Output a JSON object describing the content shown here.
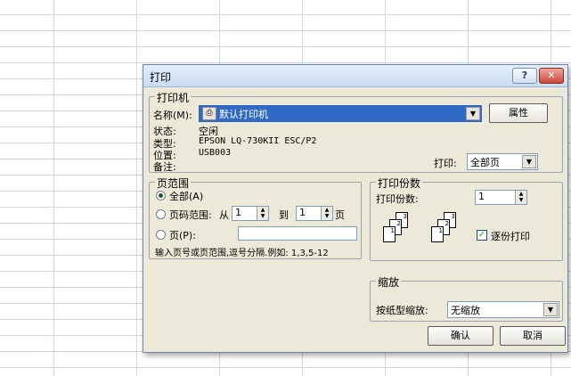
{
  "dialog": {
    "title": "打印",
    "help_label": "?",
    "close_label": "✕"
  },
  "printer": {
    "group_label": "打印机",
    "name_label": "名称(M):",
    "name_value": "默认打印机",
    "properties_label": "属性",
    "status_label": "状态:",
    "status_value": "空闲",
    "type_label": "类型:",
    "type_value": "EPSON LQ-730KII ESC/P2",
    "location_label": "位置:",
    "location_value": "USB003",
    "comment_label": "备注:",
    "print_label": "打印:",
    "print_value": "全部页"
  },
  "page_range": {
    "group_label": "页范围",
    "all_label": "全部(A)",
    "pages_label": "页码范围:",
    "from_label": "从",
    "from_value": "1",
    "to_label": "到",
    "to_value": "1",
    "page_suffix": "页",
    "page_label": "页(P):",
    "hint": "输入页号或页范围,逗号分隔.例如: 1,3,5-12"
  },
  "copies": {
    "group_label": "打印份数",
    "count_label": "打印份数:",
    "count_value": "1",
    "collate_label": "逐份打印"
  },
  "zoom": {
    "group_label": "缩放",
    "scale_label": "按纸型缩放:",
    "scale_value": "无缩放"
  },
  "buttons": {
    "ok_label": "确认",
    "cancel_label": "取消"
  }
}
